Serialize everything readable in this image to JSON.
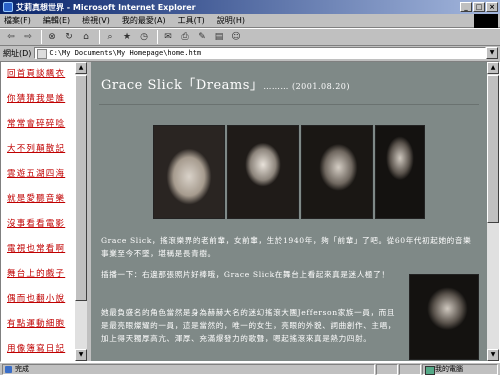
{
  "window": {
    "title": "艾莉真想世界 - Microsoft Internet Explorer",
    "btn_min": "_",
    "btn_max": "□",
    "btn_close": "×"
  },
  "menu": {
    "items": [
      "檔案(F)",
      "編輯(E)",
      "檢視(V)",
      "我的最愛(A)",
      "工具(T)",
      "說明(H)"
    ]
  },
  "toolbar": {
    "icons": [
      "back-icon",
      "forward-icon",
      "stop-icon",
      "refresh-icon",
      "home-icon",
      "search-icon",
      "favorites-icon",
      "history-icon",
      "mail-icon",
      "print-icon",
      "edit-icon",
      "discuss-icon",
      "messenger-icon"
    ]
  },
  "address": {
    "label": "網址(D)",
    "value": "C:\\My Documents\\My Homepage\\home.htm",
    "dropdown": "▼"
  },
  "sidebar": {
    "links": [
      "回首頁談飆衣",
      "你猜猜我是誰",
      "常常會碎碎唸",
      "大不列顛散記",
      "雲遊五湖四海",
      "就是愛聽音樂",
      "沒事看看電影",
      "電視也常看啊",
      "舞台上的戲子",
      "偶而也翻小說",
      "有點運動細胞",
      "用像簿寫日記"
    ]
  },
  "article": {
    "title": "Grace Slick「Dreams」",
    "date": "……… (2001.08.20)",
    "para1": "Grace Slick，搖滾樂界的老前輩，女前輩，生於1940年，夠「前輩」了吧。從60年代初起她的音樂事業至今不墜，堪稱是長青樹。",
    "para2": "插播一下：右邊那張照片好棒哦，Grace Slick在舞台上看起來真是迷人極了！",
    "para3": "她最負盛名的角色當然是身為赫赫大名的迷幻搖滾大團Jefferson家族一員，而且是最亮眼燦耀的一員，這是當然的，唯一的女生，亮眼的外貌、詞曲創作、主唱，加上得天獨厚高亢、渾厚、充滿爆發力的歌聲，嗯起搖滾來真是熱力四射。"
  },
  "status": {
    "text": "完成",
    "zone": "我的電腦"
  },
  "scroll": {
    "up": "▲",
    "down": "▼"
  }
}
